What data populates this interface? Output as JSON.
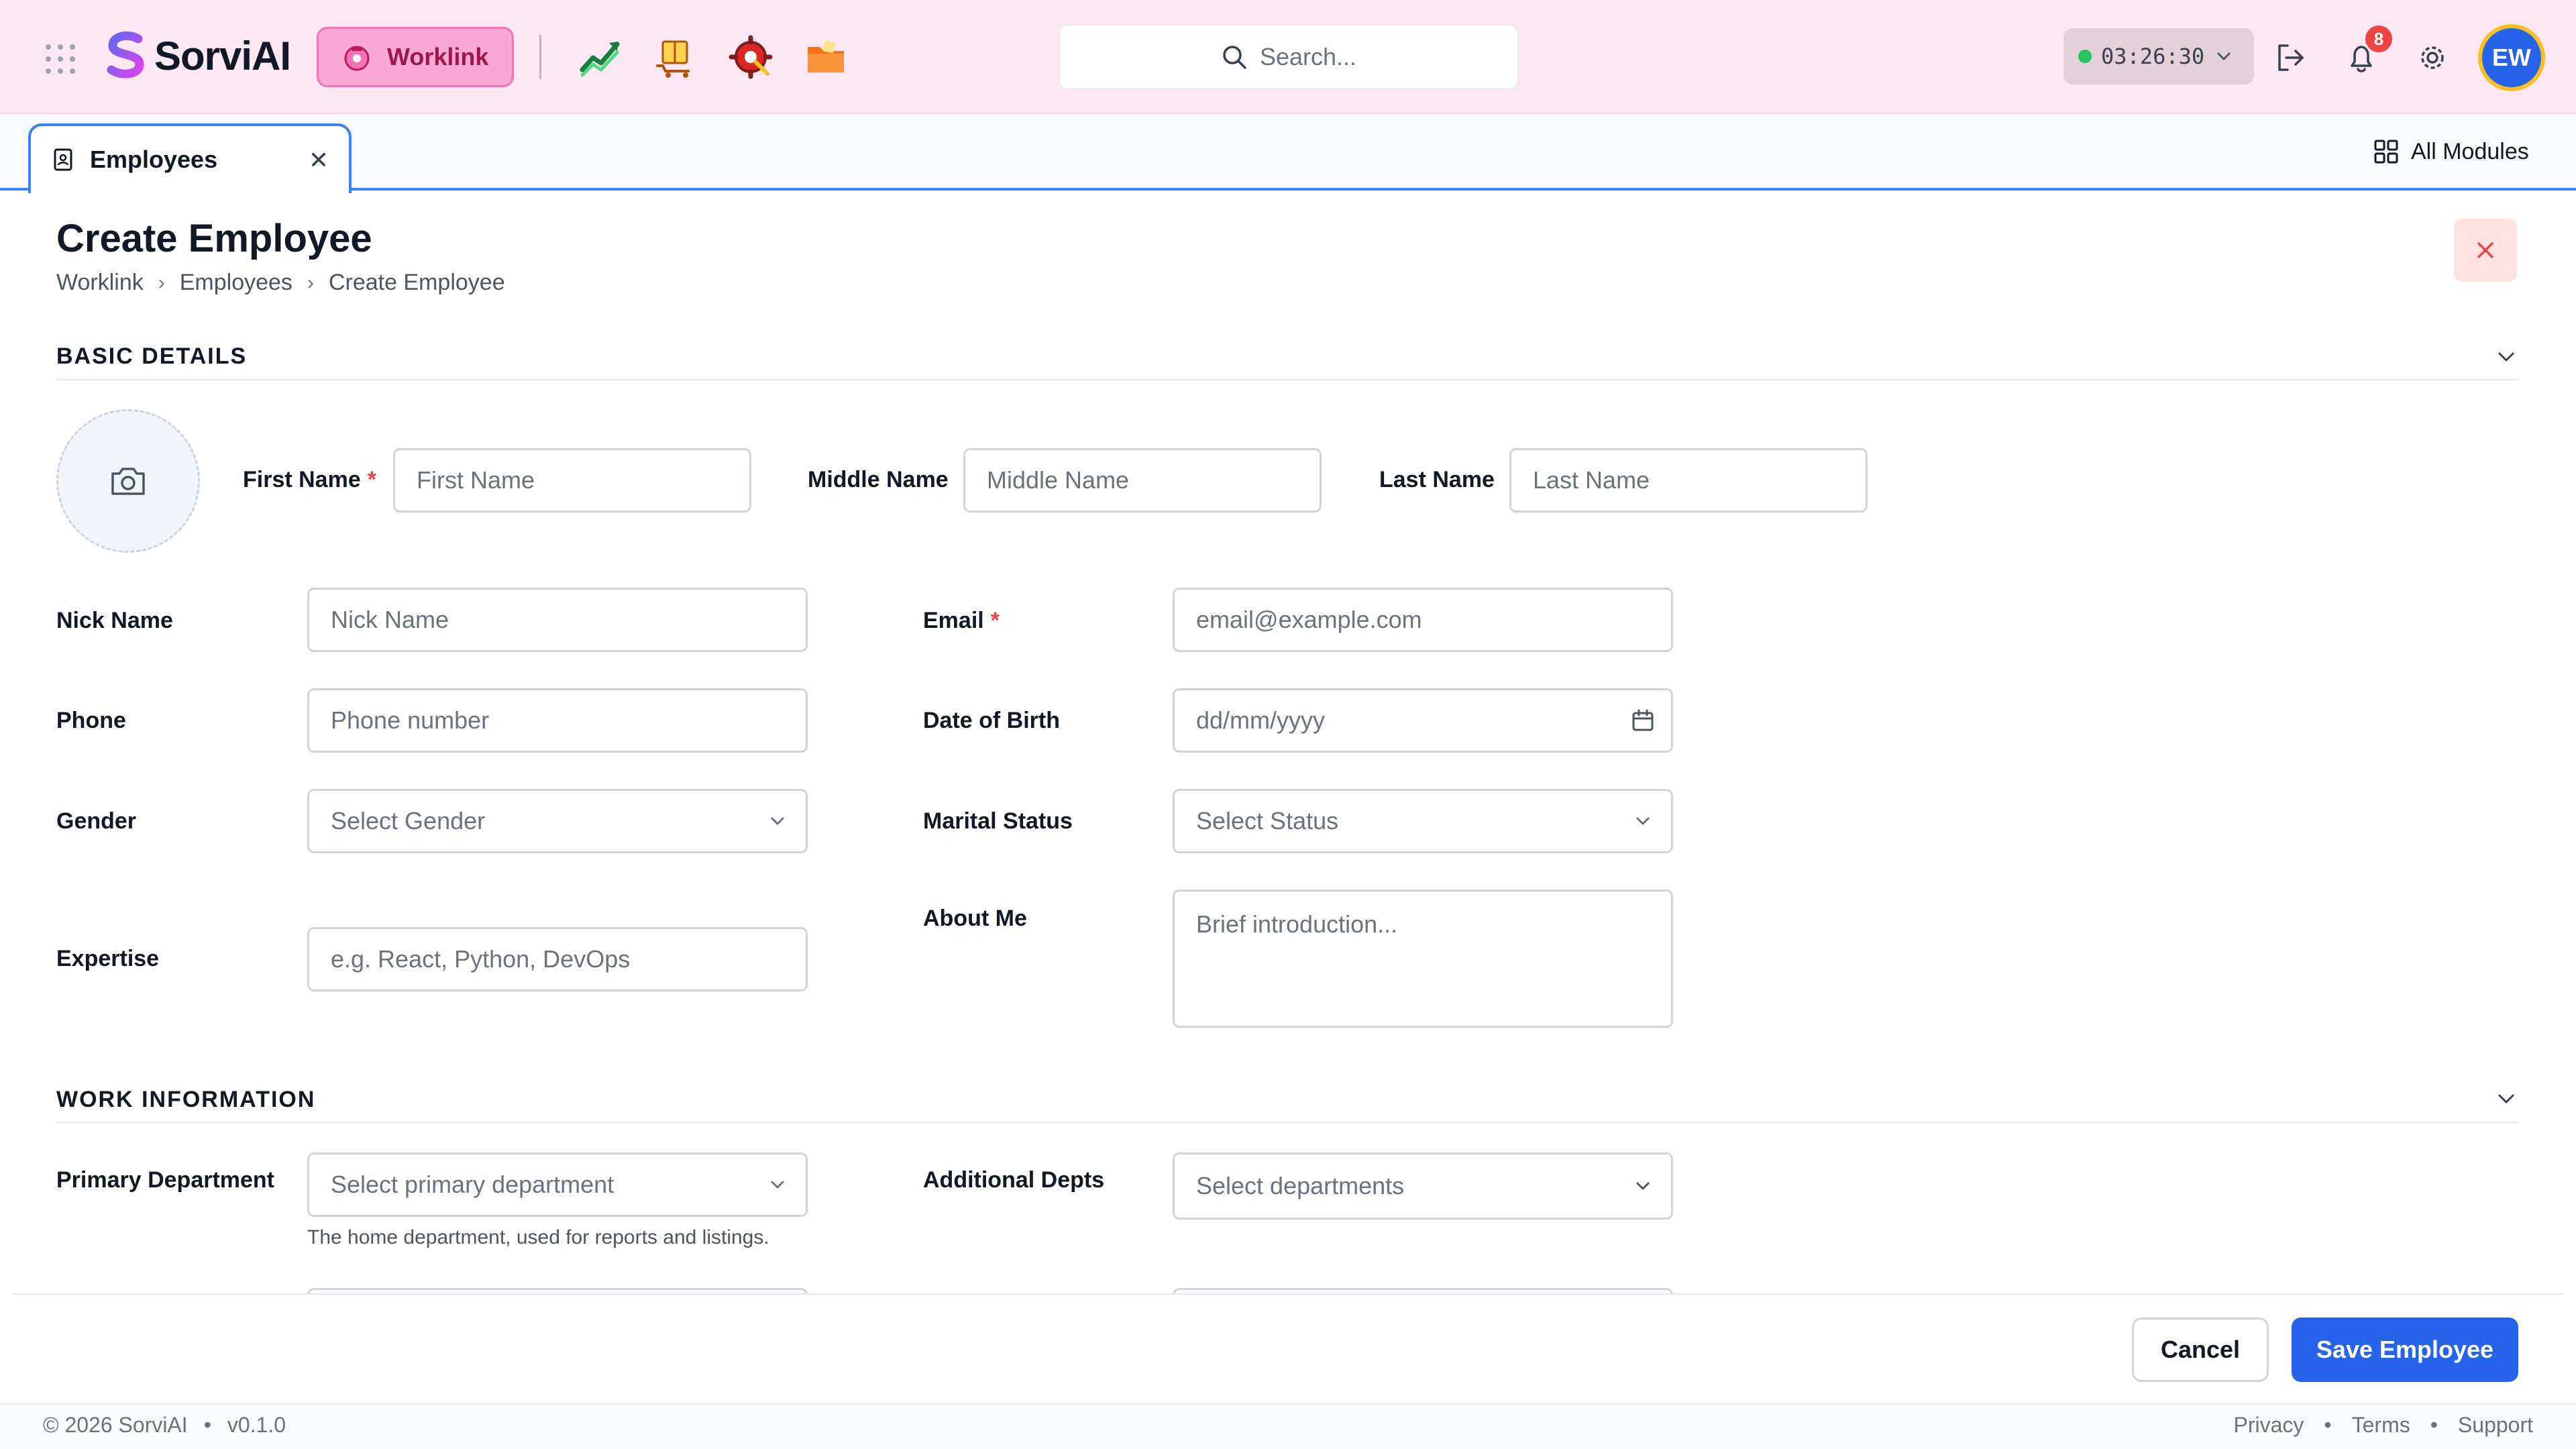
{
  "app": {
    "name": "SorviAI",
    "module_pill": "Worklink",
    "search_placeholder": "Search...",
    "timer": "03:26:30",
    "notification_count": "8",
    "user_initials": "EW"
  },
  "tabs": {
    "active": "Employees",
    "all_modules": "All Modules"
  },
  "page": {
    "title": "Create Employee",
    "breadcrumb": [
      "Worklink",
      "Employees",
      "Create Employee"
    ]
  },
  "basic_details": {
    "title": "BASIC DETAILS",
    "first_name": {
      "label": "First Name",
      "placeholder": "First Name",
      "required": "*"
    },
    "middle_name": {
      "label": "Middle Name",
      "placeholder": "Middle Name"
    },
    "last_name": {
      "label": "Last Name",
      "placeholder": "Last Name"
    },
    "nick_name": {
      "label": "Nick Name",
      "placeholder": "Nick Name"
    },
    "email": {
      "label": "Email",
      "placeholder": "email@example.com",
      "required": "*"
    },
    "phone": {
      "label": "Phone",
      "placeholder": "Phone number"
    },
    "dob": {
      "label": "Date of Birth",
      "placeholder": "dd/mm/yyyy"
    },
    "gender": {
      "label": "Gender",
      "placeholder": "Select Gender"
    },
    "marital": {
      "label": "Marital Status",
      "placeholder": "Select Status"
    },
    "expertise": {
      "label": "Expertise",
      "placeholder": "e.g. React, Python, DevOps"
    },
    "about": {
      "label": "About Me",
      "placeholder": "Brief introduction..."
    }
  },
  "work_info": {
    "title": "WORK INFORMATION",
    "primary_dept": {
      "label": "Primary Department",
      "placeholder": "Select primary department",
      "hint": "The home department, used for reports and listings."
    },
    "additional_depts": {
      "label": "Additional Depts",
      "placeholder": "Select departments"
    }
  },
  "actions": {
    "cancel": "Cancel",
    "save": "Save Employee"
  },
  "footer": {
    "copyright": "© 2026 SorviAI",
    "version": "v0.1.0",
    "bullet": "•",
    "links": [
      "Privacy",
      "Terms",
      "Support"
    ]
  },
  "colors": {
    "topbar_bg": "#fce7f3",
    "accent": "#2563eb",
    "tab_border": "#3b82f6",
    "required": "#ef4444"
  }
}
